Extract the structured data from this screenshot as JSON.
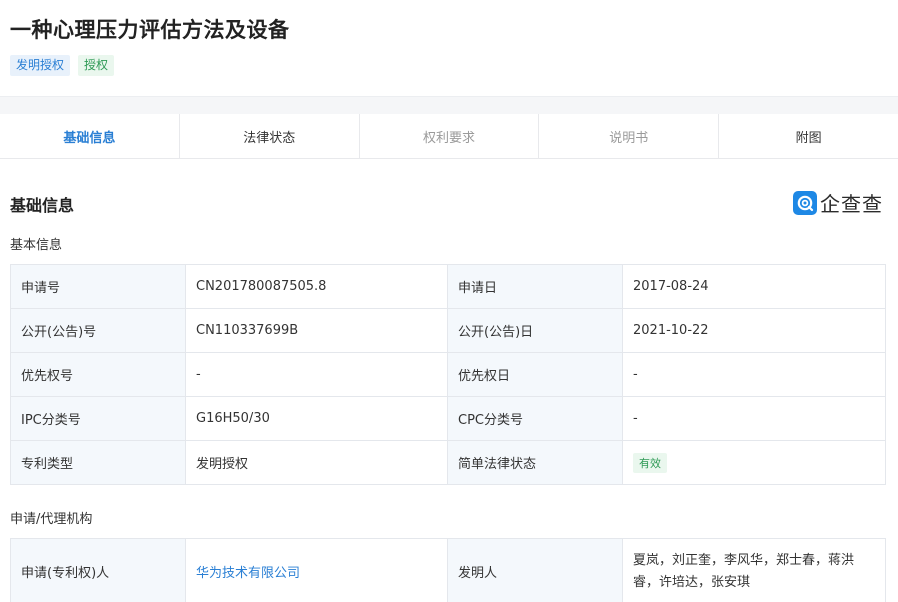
{
  "header": {
    "title": "一种心理压力评估方法及设备",
    "tags": [
      "发明授权",
      "授权"
    ]
  },
  "tabs": [
    {
      "label": "基础信息",
      "state": "active"
    },
    {
      "label": "法律状态",
      "state": "normal"
    },
    {
      "label": "权利要求",
      "state": "disabled"
    },
    {
      "label": "说明书",
      "state": "disabled"
    },
    {
      "label": "附图",
      "state": "normal"
    }
  ],
  "section": {
    "title": "基础信息",
    "logo_text": "企查查"
  },
  "basic": {
    "title": "基本信息",
    "rows": [
      {
        "l1": "申请号",
        "v1": "CN201780087505.8",
        "l2": "申请日",
        "v2": "2017-08-24"
      },
      {
        "l1": "公开(公告)号",
        "v1": "CN110337699B",
        "l2": "公开(公告)日",
        "v2": "2021-10-22"
      },
      {
        "l1": "优先权号",
        "v1": "-",
        "l2": "优先权日",
        "v2": "-"
      },
      {
        "l1": "IPC分类号",
        "v1": "G16H50/30",
        "l2": "CPC分类号",
        "v2": "-"
      },
      {
        "l1": "专利类型",
        "v1": "发明授权",
        "l2": "简单法律状态",
        "v2": "有效"
      }
    ]
  },
  "agency": {
    "title": "申请/代理机构",
    "applicant_label": "申请(专利权)人",
    "applicant_value": "华为技术有限公司",
    "inventor_label": "发明人",
    "inventor_value": "夏岚，刘正奎，李风华，郑士春，蒋洪睿，许培达，张安琪"
  },
  "colors": {
    "accent": "#2a7fd4",
    "status_green": "#2e9a55",
    "label_bg": "#f4f8fc"
  }
}
